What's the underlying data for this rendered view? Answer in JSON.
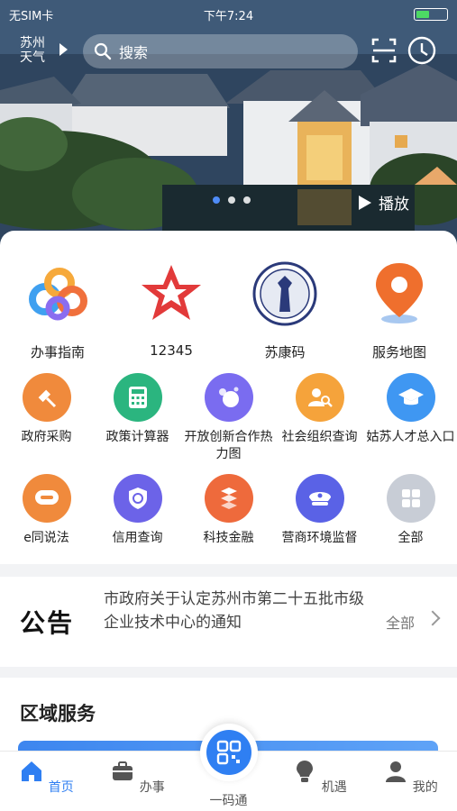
{
  "status_bar": {
    "carrier": "无SIM卡",
    "time": "下午7:24"
  },
  "header": {
    "weather_label": "苏州天气",
    "search_placeholder": "搜索",
    "play_label": "播放"
  },
  "featured_services": [
    {
      "label": "办事指南",
      "icon": "swirl-logo-icon"
    },
    {
      "label": "12345",
      "icon": "red-star-icon"
    },
    {
      "label": "苏康码",
      "icon": "seal-emblem-icon"
    },
    {
      "label": "服务地图",
      "icon": "map-pin-icon"
    }
  ],
  "services": [
    {
      "label": "政府采购",
      "icon": "gavel-icon",
      "color": "#f08a3c"
    },
    {
      "label": "政策计算器",
      "icon": "calculator-icon",
      "color": "#2bb57f"
    },
    {
      "label": "开放创新合作热力图",
      "icon": "bubbles-icon",
      "color": "#7a6cf0"
    },
    {
      "label": "社会组织查询",
      "icon": "person-search-icon",
      "color": "#f5a33b"
    },
    {
      "label": "姑苏人才总入口",
      "icon": "graduation-cap-icon",
      "color": "#3f97f2"
    },
    {
      "label": "e同说法",
      "icon": "chat-law-icon",
      "color": "#f08a3c"
    },
    {
      "label": "信用查询",
      "icon": "credit-shield-icon",
      "color": "#6c63e8"
    },
    {
      "label": "科技金融",
      "icon": "finance-icon",
      "color": "#ee6a3c"
    },
    {
      "label": "营商环境监督",
      "icon": "police-cap-icon",
      "color": "#5a62e6"
    },
    {
      "label": "全部",
      "icon": "grid-icon",
      "color": "#c8cdd6"
    }
  ],
  "notice": {
    "title": "公告",
    "text": "市政府关于认定苏州市第二十五批市级企业技术中心的通知",
    "more_label": "全部"
  },
  "region": {
    "title": "区域服务"
  },
  "tab_bar": [
    {
      "label": "首页",
      "icon": "home-icon",
      "active": true
    },
    {
      "label": "办事",
      "icon": "briefcase-icon",
      "active": false
    },
    {
      "label": "一码通",
      "icon": "qr-code-icon",
      "active": false
    },
    {
      "label": "机遇",
      "icon": "lightbulb-icon",
      "active": false
    },
    {
      "label": "我的",
      "icon": "profile-icon",
      "active": false
    }
  ],
  "colors": {
    "accent": "#2f7ff2"
  }
}
